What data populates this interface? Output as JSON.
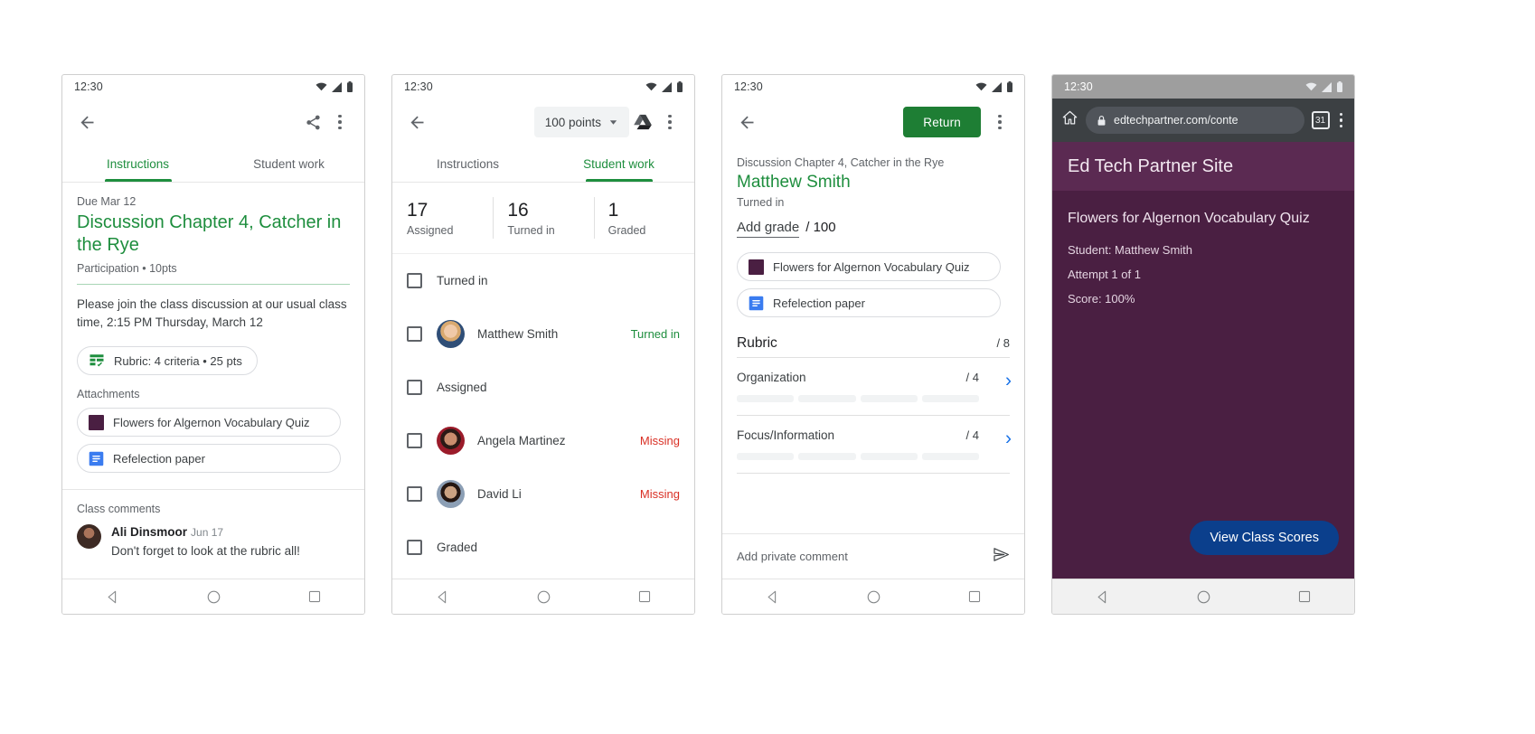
{
  "status_bar": {
    "time": "12:30"
  },
  "phone1": {
    "name": "assignment-instructions",
    "tabs": [
      {
        "label": "Instructions",
        "active": true
      },
      {
        "label": "Student work",
        "active": false
      }
    ],
    "due": "Due Mar 12",
    "title": "Discussion Chapter 4, Catcher in the Rye",
    "meta": "Participation • 10pts",
    "description": "Please join the class discussion at our usual class time, 2:15 PM Thursday, March 12",
    "rubric_chip": "Rubric: 4 criteria • 25 pts",
    "attachments_label": "Attachments",
    "attachments": [
      {
        "label": "Flowers for Algernon Vocabulary Quiz",
        "icon": "purple-square-icon"
      },
      {
        "label": "Refelection paper",
        "icon": "google-docs-icon"
      }
    ],
    "comments_label": "Class comments",
    "comment": {
      "author": "Ali Dinsmoor",
      "date": "Jun 17",
      "text": "Don't forget to look at the rubric all!"
    }
  },
  "phone2": {
    "name": "student-work",
    "points_selector": "100 points",
    "tabs": [
      {
        "label": "Instructions",
        "active": false
      },
      {
        "label": "Student work",
        "active": true
      }
    ],
    "stats": [
      {
        "value": "17",
        "label": "Assigned"
      },
      {
        "value": "16",
        "label": "Turned in"
      },
      {
        "value": "1",
        "label": "Graded"
      }
    ],
    "rows": [
      {
        "type": "group",
        "label": "Turned in"
      },
      {
        "type": "student",
        "name": "Matthew Smith",
        "status": "Turned in",
        "status_kind": "turned",
        "avatar": "av-matt"
      },
      {
        "type": "group",
        "label": "Assigned"
      },
      {
        "type": "student",
        "name": "Angela Martinez",
        "status": "Missing",
        "status_kind": "missing",
        "avatar": "av-ang"
      },
      {
        "type": "student",
        "name": "David Li",
        "status": "Missing",
        "status_kind": "missing",
        "avatar": "av-dav"
      },
      {
        "type": "group",
        "label": "Graded"
      }
    ]
  },
  "phone3": {
    "name": "grading-detail",
    "return_button": "Return",
    "assignment": "Discussion Chapter 4, Catcher in the Rye",
    "student": "Matthew Smith",
    "state": "Turned in",
    "add_grade": "Add grade",
    "grade_denominator": "/ 100",
    "attachments": [
      {
        "label": "Flowers for Algernon Vocabulary Quiz",
        "icon": "purple-square-icon"
      },
      {
        "label": "Refelection paper",
        "icon": "google-docs-icon"
      }
    ],
    "rubric_title": "Rubric",
    "rubric_total": "/ 8",
    "criteria": [
      {
        "name": "Organization",
        "points": "/ 4",
        "levels": 4
      },
      {
        "name": "Focus/Information",
        "points": "/ 4",
        "levels": 4
      }
    ],
    "private_comment_placeholder": "Add private comment"
  },
  "phone4": {
    "name": "browser-quiz-result",
    "url": "edtechpartner.com/conte",
    "tab_count": "31",
    "site_title": "Ed Tech Partner Site",
    "quiz_title": "Flowers for Algernon Vocabulary Quiz",
    "lines": [
      "Student: Matthew Smith",
      "Attempt 1 of 1",
      "Score: 100%"
    ],
    "view_scores_button": "View Class Scores"
  },
  "colors": {
    "green": "#1e8e3e",
    "return_green": "#1e7e34",
    "red": "#d93025",
    "blue": "#1a73e8",
    "purple": "#4a1f42",
    "site_blue": "#0b3f8c"
  }
}
